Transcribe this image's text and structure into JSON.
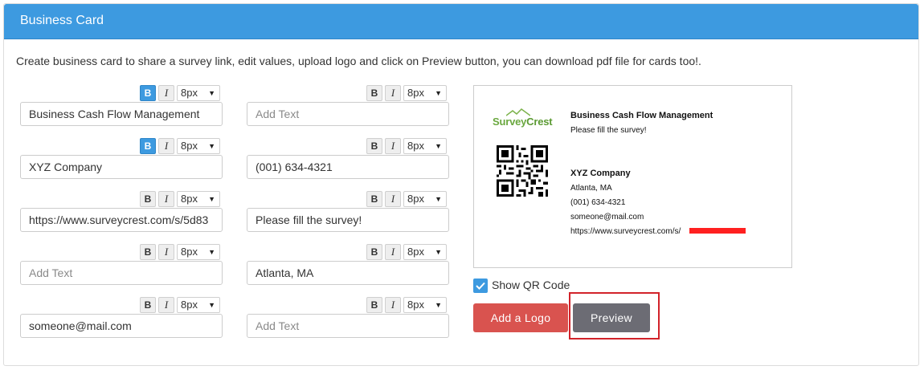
{
  "header": {
    "title": "Business Card"
  },
  "description": "Create business card to share a survey link, edit values, upload logo and click on Preview button, you can download pdf file for cards too!.",
  "toolbar": {
    "bold": "B",
    "italic": "I",
    "caret": "▼"
  },
  "left_fields": [
    {
      "value": "Business Cash Flow Management",
      "placeholder": "Add Text",
      "font_size": "8px",
      "bold_active": true
    },
    {
      "value": "XYZ Company",
      "placeholder": "Add Text",
      "font_size": "8px",
      "bold_active": true
    },
    {
      "value": "https://www.surveycrest.com/s/5d83",
      "placeholder": "Add Text",
      "font_size": "8px",
      "bold_active": false
    },
    {
      "value": "",
      "placeholder": "Add Text",
      "font_size": "8px",
      "bold_active": false
    },
    {
      "value": "someone@mail.com",
      "placeholder": "Add Text",
      "font_size": "8px",
      "bold_active": false
    }
  ],
  "right_fields": [
    {
      "value": "",
      "placeholder": "Add Text",
      "font_size": "8px",
      "bold_active": false
    },
    {
      "value": "(001) 634-4321",
      "placeholder": "Add Text",
      "font_size": "8px",
      "bold_active": false
    },
    {
      "value": "Please fill the survey!",
      "placeholder": "Add Text",
      "font_size": "8px",
      "bold_active": false
    },
    {
      "value": "Atlanta, MA",
      "placeholder": "Add Text",
      "font_size": "8px",
      "bold_active": false
    },
    {
      "value": "",
      "placeholder": "Add Text",
      "font_size": "8px",
      "bold_active": false
    }
  ],
  "card_preview": {
    "logo_part1": "Survey",
    "logo_part2": "Crest",
    "title": "Business Cash Flow Management",
    "subtitle": "Please fill the survey!",
    "company": "XYZ Company",
    "location": "Atlanta, MA",
    "phone": "(001) 634-4321",
    "email": "someone@mail.com",
    "url": "https://www.surveycrest.com/s/"
  },
  "qr_toggle": {
    "label": "Show QR Code",
    "checked": true
  },
  "buttons": {
    "add_logo": "Add a Logo",
    "preview": "Preview"
  },
  "colors": {
    "header": "#3d9ae0",
    "danger": "#d9534f",
    "secondary": "#6c6c74",
    "highlight": "#d2232a",
    "logo_green": "#6aa83f"
  }
}
